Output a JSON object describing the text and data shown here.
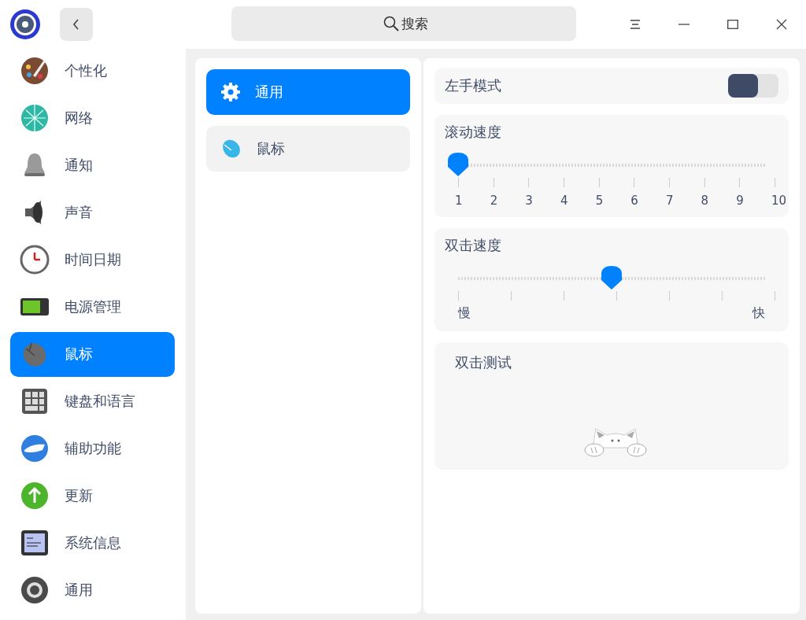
{
  "search": {
    "placeholder": "搜索"
  },
  "sidebar": {
    "items": [
      {
        "label": "个性化",
        "selected": false
      },
      {
        "label": "网络",
        "selected": false
      },
      {
        "label": "通知",
        "selected": false
      },
      {
        "label": "声音",
        "selected": false
      },
      {
        "label": "时间日期",
        "selected": false
      },
      {
        "label": "电源管理",
        "selected": false
      },
      {
        "label": "鼠标",
        "selected": true
      },
      {
        "label": "键盘和语言",
        "selected": false
      },
      {
        "label": "辅助功能",
        "selected": false
      },
      {
        "label": "更新",
        "selected": false
      },
      {
        "label": "系统信息",
        "selected": false
      },
      {
        "label": "通用",
        "selected": false
      }
    ]
  },
  "subnav": {
    "items": [
      {
        "label": "通用",
        "selected": true
      },
      {
        "label": "鼠标",
        "selected": false
      }
    ]
  },
  "settings": [
    {
      "kind": "toggle",
      "label": "左手模式",
      "on": false
    },
    {
      "kind": "numbered_slider",
      "label": "滚动速度",
      "level": 0,
      "tick_labels": [
        "1",
        "2",
        "3",
        "4",
        "5",
        "6",
        "7",
        "8",
        "9",
        "10"
      ]
    },
    {
      "kind": "range_slider",
      "label": "双击速度",
      "level": 0.5,
      "min_label": "慢",
      "max_label": "快"
    },
    {
      "kind": "test_area",
      "label": "双击测试"
    }
  ]
}
